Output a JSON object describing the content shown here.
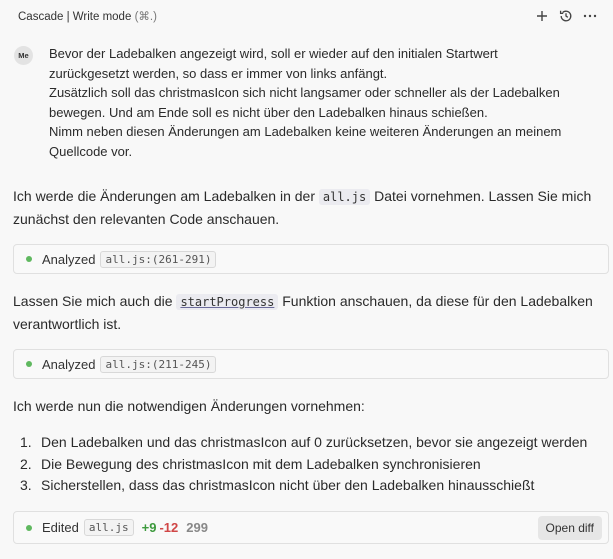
{
  "header": {
    "title": "Cascade | Write mode",
    "shortcut": "(⌘.)",
    "icons": [
      "plus-icon",
      "history-icon",
      "more-icon"
    ]
  },
  "user_message": {
    "avatar": "Me",
    "lines": [
      "Bevor der Ladebalken angezeigt wird, soll er wieder auf den initialen Startwert",
      "zurückgesetzt werden, so dass er immer von links anfängt.",
      "Zusätzlich soll das christmasIcon sich nicht langsamer oder schneller als der Ladebalken",
      "bewegen. Und am Ende soll es nicht über den Ladebalken hinaus schießen.",
      "Nimm neben diesen Änderungen am Ladebalken keine weiteren Änderungen an meinem",
      "Quellcode vor."
    ]
  },
  "assistant": {
    "para1": {
      "before": "Ich werde die Änderungen am Ladebalken in der ",
      "code": "all.js",
      "after": " Datei vornehmen. Lassen Sie mich zunächst den relevanten Code anschauen."
    },
    "tool1": {
      "label": "Analyzed",
      "ref": "all.js:(261-291)"
    },
    "para2": {
      "before": "Lassen Sie mich auch die ",
      "code": "startProgress",
      "after": " Funktion anschauen, da diese für den Ladebalken verantwortlich ist."
    },
    "tool2": {
      "label": "Analyzed",
      "ref": "all.js:(211-245)"
    },
    "para3": "Ich werde nun die notwendigen Änderungen vornehmen:",
    "list": [
      {
        "num": "1.",
        "text": "Den Ladebalken und das christmasIcon auf 0 zurücksetzen, bevor sie angezeigt werden"
      },
      {
        "num": "2.",
        "text": "Die Bewegung des christmasIcon mit dem Ladebalken synchronisieren"
      },
      {
        "num": "3.",
        "text": "Sicherstellen, dass das christmasIcon nicht über den Ladebalken hinausschießt"
      }
    ],
    "edit": {
      "label": "Edited",
      "file": "all.js",
      "added": "+9",
      "removed": "-12",
      "total": "299",
      "button": "Open diff"
    }
  },
  "colors": {
    "success_dot": "#5fb85f",
    "added": "#3d9a3d",
    "removed": "#d04646"
  }
}
